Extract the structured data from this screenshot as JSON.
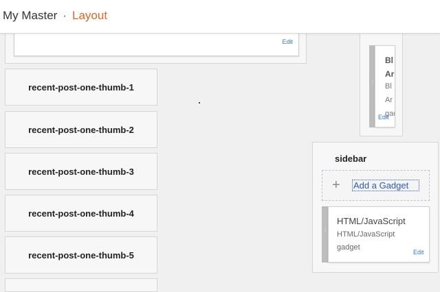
{
  "header": {
    "title": "My Master",
    "separator": "·",
    "active_page": "Layout"
  },
  "top_section": {
    "edit_label": "Edit"
  },
  "right_top_gadget": {
    "line1": "Bl",
    "line2": "Ar",
    "line3": "Bl",
    "line4": "Ar",
    "line5": "gad",
    "edit_label": "Edit"
  },
  "thumb_sections": [
    {
      "label": "recent-post-one-thumb-1"
    },
    {
      "label": "recent-post-one-thumb-2"
    },
    {
      "label": "recent-post-one-thumb-3"
    },
    {
      "label": "recent-post-one-thumb-4"
    },
    {
      "label": "recent-post-one-thumb-5"
    }
  ],
  "sidebar": {
    "title": "sidebar",
    "add_gadget_label": "Add a Gadget",
    "add_icon": "plus-icon",
    "gadget": {
      "title": "HTML/JavaScript",
      "subtitle_line1": "HTML/JavaScript",
      "subtitle_line2": "gadget",
      "edit_label": "Edit"
    }
  },
  "colors": {
    "accent": "#dd6622",
    "link": "#3a78c4",
    "add_gadget_link": "#2a56c6",
    "background": "#f0f0f0"
  }
}
